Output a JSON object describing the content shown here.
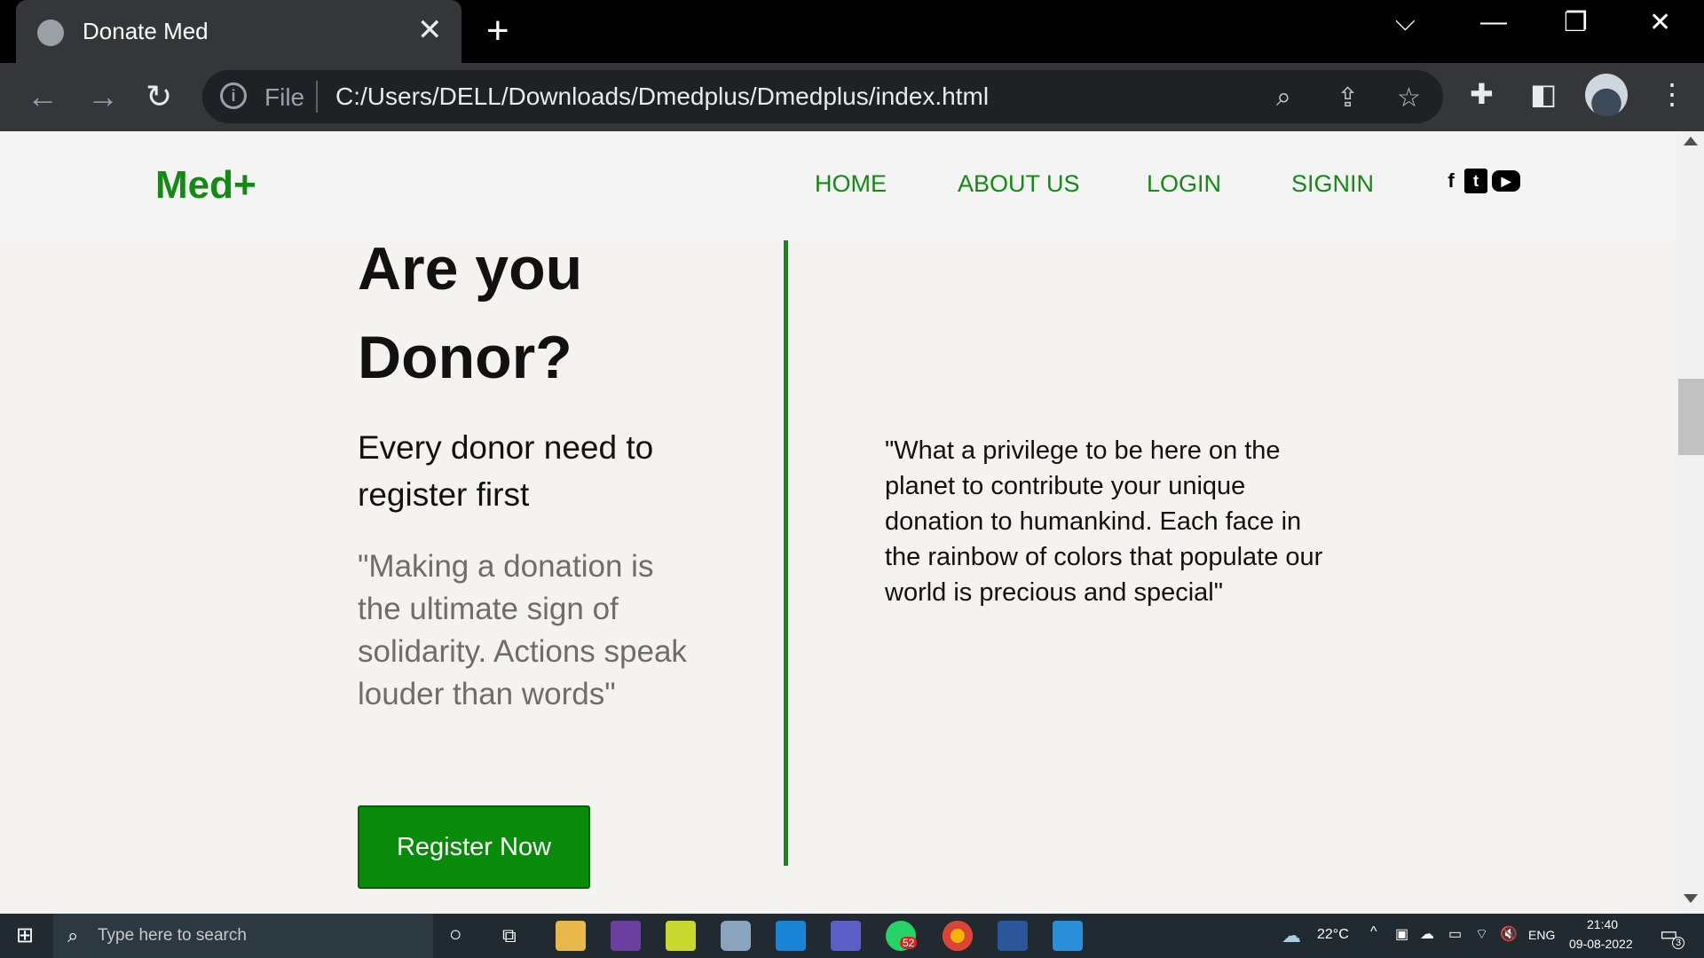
{
  "browser": {
    "tab_title": "Donate Med",
    "tab_close": "✕",
    "new_tab": "+",
    "url_scheme": "File",
    "url": "C:/Users/DELL/Downloads/Dmedplus/Dmedplus/index.html"
  },
  "site": {
    "logo": "Med+",
    "nav": [
      "HOME",
      "ABOUT US",
      "LOGIN",
      "SIGNIN"
    ],
    "social": {
      "facebook": "f",
      "twitter": "t",
      "youtube": "▶"
    }
  },
  "content": {
    "heading": "Are you Donor?",
    "subheading": "Every donor need to register first",
    "quote_left": "\"Making a donation is the ultimate sign of solidarity. Actions speak louder than words\"",
    "button": "Register Now",
    "quote_right": "\"What a privilege to be here on the planet to contribute your unique donation to humankind. Each face in the rainbow of colors that populate our world is precious and special\""
  },
  "taskbar": {
    "search_placeholder": "Type here to search",
    "weather": "22°C",
    "language": "ENG",
    "time": "21:40",
    "date": "09-08-2022",
    "whatsapp_badge": "52",
    "notification_badge": "3"
  },
  "colors": {
    "brand_green": "#138a13",
    "button_green": "#0a8a0a",
    "page_bg": "#f4f3ef"
  }
}
